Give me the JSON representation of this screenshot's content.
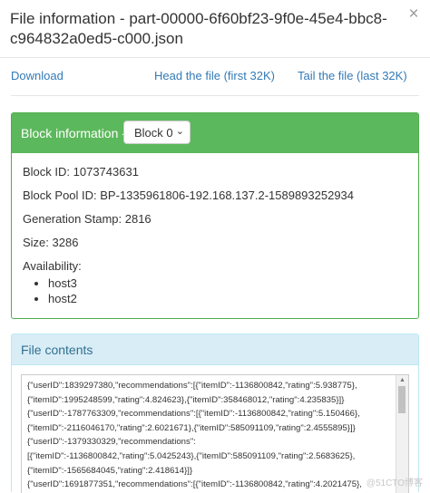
{
  "modal": {
    "title_line1": "File information - part-00000-6f60bf23-9f0e-45e4-bbc8-",
    "title_line2": "c964832a0ed5-c000.json",
    "close": "×"
  },
  "links": {
    "download": "Download",
    "head": "Head the file (first 32K)",
    "tail": "Tail the file (last 32K)"
  },
  "block": {
    "header": "Block information --",
    "selected": "Block 0",
    "block_id": "Block ID: 1073743631",
    "pool_id": "Block Pool ID: BP-1335961806-192.168.137.2-1589893252934",
    "gen_stamp": "Generation Stamp: 2816",
    "size": "Size: 3286",
    "availability": "Availability:",
    "hosts": [
      "host3",
      "host2"
    ]
  },
  "contents": {
    "header": "File contents",
    "lines": [
      "{\"userID\":1839297380,\"recommendations\":[{\"itemID\":-1136800842,\"rating\":5.938775},",
      "{\"itemID\":1995248599,\"rating\":4.824623},{\"itemID\":358468012,\"rating\":4.235835}]}",
      "{\"userID\":-1787763309,\"recommendations\":[{\"itemID\":-1136800842,\"rating\":5.150466},",
      "{\"itemID\":-2116046170,\"rating\":2.6021671},{\"itemID\":585091109,\"rating\":2.4555895}]}",
      "{\"userID\":-1379330329,\"recommendations\":",
      "[{\"itemID\":-1136800842,\"rating\":5.0425243},{\"itemID\":585091109,\"rating\":2.5683625},",
      "{\"itemID\":-1565684045,\"rating\":2.418614}]}",
      "{\"userID\":1691877351,\"recommendations\":[{\"itemID\":-1136800842,\"rating\":4.2021475},"
    ]
  },
  "watermark": "@51CTO博客"
}
